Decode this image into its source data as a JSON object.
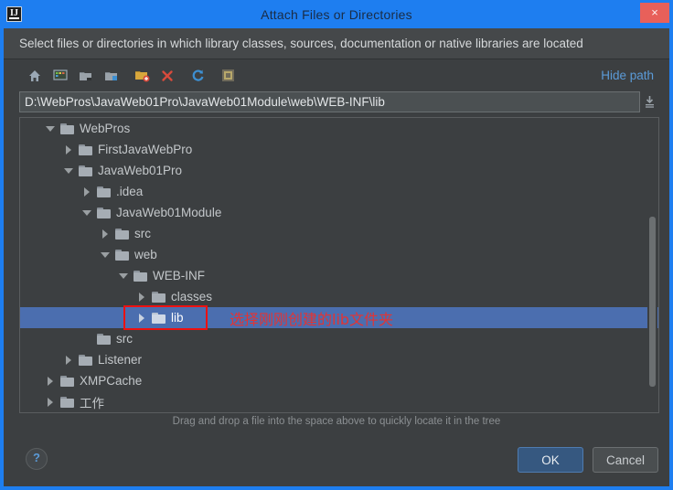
{
  "window": {
    "title": "Attach Files or Directories",
    "app_icon": "intellij-idea-logo-icon",
    "close_label": "×",
    "accent_color": "#1e7ef0",
    "background_color": "#3c3f41"
  },
  "description": {
    "text": "Select files or directories in which library classes, sources, documentation or native libraries are located"
  },
  "toolbar": {
    "icons": [
      {
        "name": "home-icon",
        "title": "Home"
      },
      {
        "name": "desktop-icon",
        "title": "Desktop"
      },
      {
        "name": "folder-up-icon",
        "title": "Up"
      },
      {
        "name": "folder-icon",
        "title": "Project Directory"
      },
      {
        "name": "new-folder-icon",
        "title": "New Folder"
      },
      {
        "name": "delete-icon",
        "title": "Delete"
      },
      {
        "name": "refresh-icon",
        "title": "Refresh"
      },
      {
        "name": "show-hidden-icon",
        "title": "Show Hidden Files"
      }
    ],
    "hide_path_label": "Hide path"
  },
  "path_field": {
    "value": "D:\\WebPros\\JavaWeb01Pro\\JavaWeb01Module\\web\\WEB-INF\\lib",
    "placeholder": "",
    "dropdown_icon": "history-dropdown-icon"
  },
  "tree": {
    "rows": [
      {
        "label": "WebPros",
        "depth": 1,
        "arrow": "down",
        "selected": false
      },
      {
        "label": "FirstJavaWebPro",
        "depth": 2,
        "arrow": "right",
        "selected": false
      },
      {
        "label": "JavaWeb01Pro",
        "depth": 2,
        "arrow": "down",
        "selected": false
      },
      {
        "label": ".idea",
        "depth": 3,
        "arrow": "right",
        "selected": false
      },
      {
        "label": "JavaWeb01Module",
        "depth": 3,
        "arrow": "down",
        "selected": false
      },
      {
        "label": "src",
        "depth": 4,
        "arrow": "right",
        "selected": false
      },
      {
        "label": "web",
        "depth": 4,
        "arrow": "down",
        "selected": false
      },
      {
        "label": "WEB-INF",
        "depth": 5,
        "arrow": "down",
        "selected": false
      },
      {
        "label": "classes",
        "depth": 6,
        "arrow": "right",
        "selected": false
      },
      {
        "label": "lib",
        "depth": 6,
        "arrow": "right",
        "selected": true
      },
      {
        "label": "src",
        "depth": 3,
        "arrow": "none",
        "selected": false
      },
      {
        "label": "Listener",
        "depth": 2,
        "arrow": "right",
        "selected": false
      },
      {
        "label": "XMPCache",
        "depth": 1,
        "arrow": "right",
        "selected": false
      },
      {
        "label": "工作",
        "depth": 1,
        "arrow": "right",
        "selected": false
      }
    ]
  },
  "annotation": {
    "text": "选择刚刚创建的lib文件夹",
    "color": "#e23434",
    "box_target": "lib"
  },
  "hint": {
    "text": "Drag and drop a file into the space above to quickly locate it in the tree"
  },
  "footer": {
    "help_label": "?",
    "ok_label": "OK",
    "cancel_label": "Cancel"
  }
}
